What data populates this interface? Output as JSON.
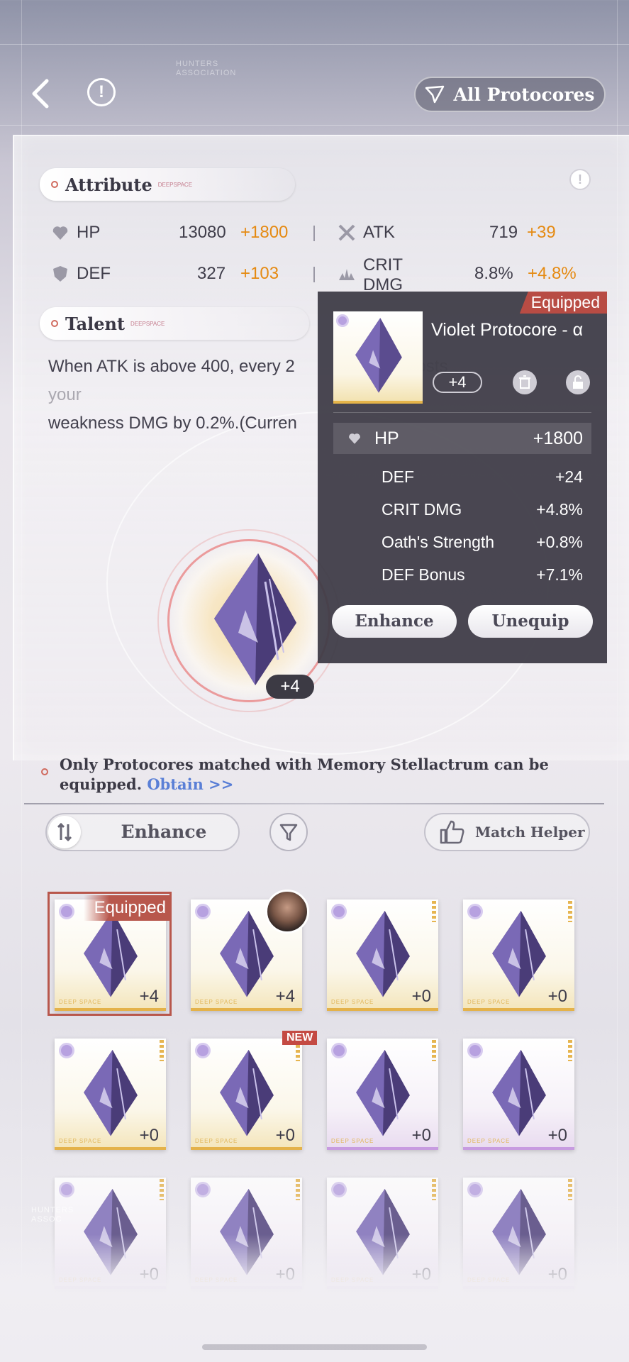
{
  "header": {
    "all_protocores_label": "All Protocores",
    "watermark_text": "HUNTERS\nASSOCIATION"
  },
  "attribute": {
    "title": "Attribute",
    "tag": "DEEPSPACE",
    "stats": [
      {
        "name": "HP",
        "base": "13080",
        "bonus": "+1800",
        "icon": "heart-icon"
      },
      {
        "name": "ATK",
        "base": "719",
        "bonus": "+39",
        "icon": "crossed-swords-icon"
      },
      {
        "name": "DEF",
        "base": "327",
        "bonus": "+103",
        "icon": "shield-icon"
      },
      {
        "name": "CRIT DMG",
        "base": "8.8%",
        "bonus": "+4.8%",
        "icon": "crit-burst-icon"
      }
    ]
  },
  "talent": {
    "title": "Talent",
    "tag": "DEEPSPACE",
    "line1": "When ATK is above 400, every 2",
    "line1_tail": "boosts your",
    "line2": "weakness DMG by 0.2%.(Curren"
  },
  "equipped_core": {
    "level": "+4"
  },
  "popup": {
    "equipped_label": "Equipped",
    "name": "Violet Protocore - α",
    "level": "+4",
    "main_stat": {
      "name": "HP",
      "value": "+1800"
    },
    "sub_stats": [
      {
        "name": "DEF",
        "value": "+24"
      },
      {
        "name": "CRIT DMG",
        "value": "+4.8%"
      },
      {
        "name": "Oath's Strength",
        "value": "+0.8%"
      },
      {
        "name": "DEF Bonus",
        "value": "+7.1%"
      }
    ],
    "enhance_label": "Enhance",
    "unequip_label": "Unequip"
  },
  "notice": {
    "text": "Only Protocores matched with Memory Stellactrum can be equipped.",
    "link": "Obtain >>"
  },
  "controls": {
    "enhance_label": "Enhance",
    "match_helper_label": "Match Helper"
  },
  "inventory": {
    "equipped_label": "Equipped",
    "new_label": "NEW",
    "deep_space_label": "DEEP SPACE",
    "items": [
      {
        "level": "+4",
        "rarity": "gold"
      },
      {
        "level": "+4",
        "rarity": "gold"
      },
      {
        "level": "+0",
        "rarity": "gold"
      },
      {
        "level": "+0",
        "rarity": "gold"
      },
      {
        "level": "+0",
        "rarity": "gold"
      },
      {
        "level": "+0",
        "rarity": "gold"
      },
      {
        "level": "+0",
        "rarity": "purple"
      },
      {
        "level": "+0",
        "rarity": "purple"
      },
      {
        "level": "+0",
        "rarity": "purple"
      },
      {
        "level": "+0",
        "rarity": "purple"
      },
      {
        "level": "+0",
        "rarity": "purple"
      },
      {
        "level": "+0",
        "rarity": "purple"
      }
    ]
  },
  "colors": {
    "accent_orange": "#e58a12",
    "equipped_red": "#b8574c",
    "link_blue": "#5a7fd6",
    "popup_bg": "#3e3c46"
  }
}
